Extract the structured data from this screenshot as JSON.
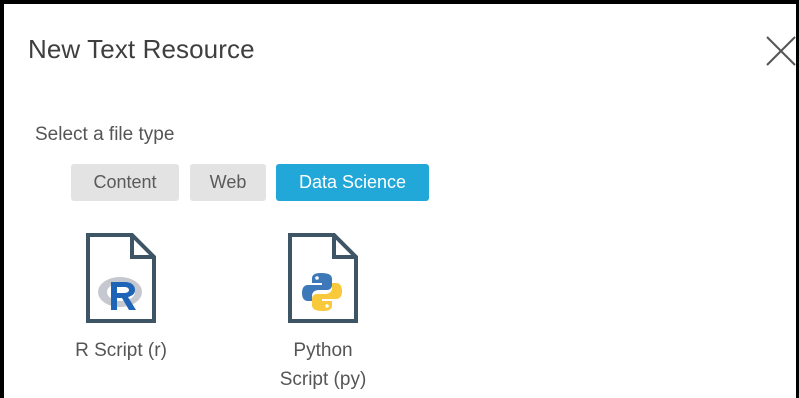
{
  "dialog": {
    "title": "New Text Resource",
    "close_icon": "close-icon"
  },
  "file_type": {
    "prompt": "Select a file type",
    "tabs": [
      {
        "label": "Content",
        "selected": false
      },
      {
        "label": "Web",
        "selected": false
      },
      {
        "label": "Data Science",
        "selected": true
      }
    ]
  },
  "files": [
    {
      "label": "R Script (r)",
      "icon": "r-script-file-icon"
    },
    {
      "label": "Python Script (py)",
      "icon": "python-script-file-icon"
    }
  ],
  "colors": {
    "accent": "#22a8d8",
    "tab_inactive": "#e3e3e3",
    "text": "#555555",
    "title_text": "#3f3f3f",
    "file_icon_stroke": "#3e5566",
    "r_blue": "#1f65b7",
    "python_blue": "#3d79b8",
    "python_yellow": "#f7c93b"
  }
}
